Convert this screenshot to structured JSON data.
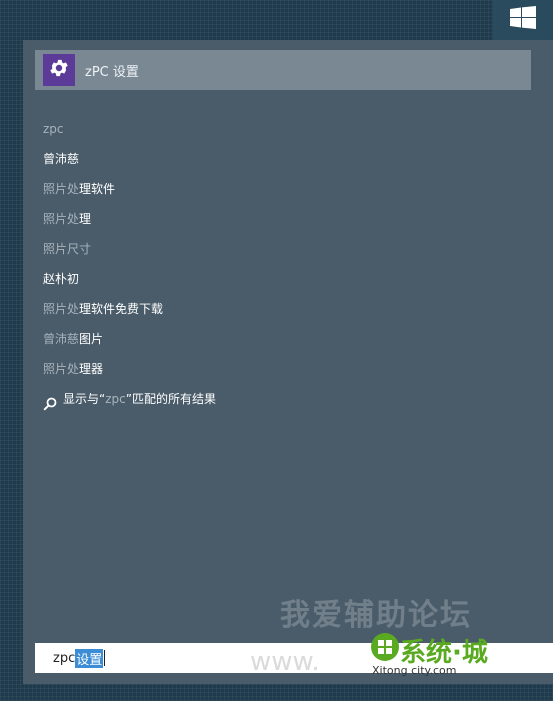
{
  "start": {
    "icon": "windows-logo-icon"
  },
  "top_result": {
    "icon": "gear-icon",
    "label": "zPC 设置"
  },
  "suggestions": [
    {
      "dim": "zpc",
      "rest": ""
    },
    {
      "dim": "",
      "rest": "曾沛慈"
    },
    {
      "dim": "照片处",
      "rest": "理软件"
    },
    {
      "dim": "照片处",
      "rest": "理"
    },
    {
      "dim": "照片尺寸",
      "rest": ""
    },
    {
      "dim": "",
      "rest": "赵朴初"
    },
    {
      "dim": "照片处",
      "rest": "理软件免费下载"
    },
    {
      "dim": "曾沛慈",
      "rest": "图片"
    },
    {
      "dim": "照片处",
      "rest": "理器"
    }
  ],
  "all_results": {
    "icon": "search-icon",
    "prefix": "显示与“",
    "term": "zpc",
    "suffix": "”匹配的所有结果"
  },
  "search_box": {
    "typed": "zpc",
    "selected": "设置"
  },
  "watermark": {
    "text": "我爱辅助论坛",
    "brand": "系统·城",
    "brand_sub": "Xitong city.com",
    "www": "www."
  },
  "colors": {
    "panel": "#4a5c6a",
    "top_result_bg": "#7a8894",
    "app_icon_bg": "#5b3b97",
    "selection": "#3b8ed6"
  }
}
